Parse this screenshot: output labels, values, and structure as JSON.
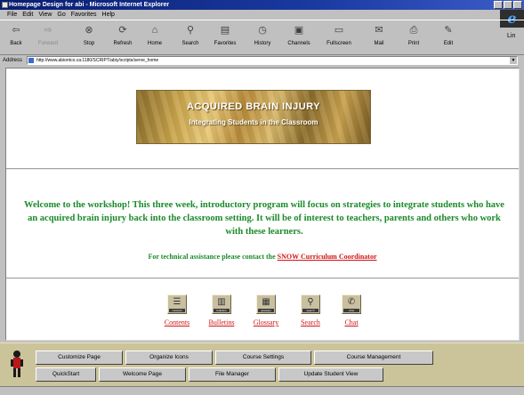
{
  "window": {
    "title": "Homepage Design for abi - Microsoft Internet Explorer"
  },
  "menu": [
    "File",
    "Edit",
    "View",
    "Go",
    "Favorites",
    "Help"
  ],
  "toolbar": {
    "buttons": [
      {
        "label": "Back",
        "icon": "back-arrow-icon"
      },
      {
        "label": "Forward",
        "icon": "forward-arrow-icon"
      },
      {
        "label": "Stop",
        "icon": "stop-icon"
      },
      {
        "label": "Refresh",
        "icon": "refresh-icon"
      },
      {
        "label": "Home",
        "icon": "home-icon"
      },
      {
        "label": "Search",
        "icon": "search-icon"
      },
      {
        "label": "Favorites",
        "icon": "favorites-icon"
      },
      {
        "label": "History",
        "icon": "history-icon"
      },
      {
        "label": "Channels",
        "icon": "channels-icon"
      },
      {
        "label": "Fullscreen",
        "icon": "fullscreen-icon"
      },
      {
        "label": "Mail",
        "icon": "mail-icon"
      },
      {
        "label": "Print",
        "icon": "print-icon"
      },
      {
        "label": "Edit",
        "icon": "edit-icon"
      }
    ],
    "links_label": "Lin"
  },
  "address": {
    "label": "Address",
    "value": "http://www.abiontco.ca:1180/SCRIPT/abiy/scripts/serve_home"
  },
  "banner": {
    "title": "ACQUIRED BRAIN INJURY",
    "subtitle": "Integrating Students in the Classroom"
  },
  "welcome_text": "Welcome to the workshop! This three week, introductory program will focus on strategies to integrate students who have an acquired brain injury back into the classroom setting. It will be of interest to teachers, parents and others who work with these learners.",
  "assist": {
    "text": "For technical assistance please contact the",
    "link": "SNOW Curriculum Coordinator"
  },
  "nav": [
    {
      "label": "Contents",
      "icon": "contents-icon",
      "caption": "contents"
    },
    {
      "label": "Bulletins",
      "icon": "bulletins-icon",
      "caption": "bulletins"
    },
    {
      "label": "Glossary",
      "icon": "glossary-icon",
      "caption": "glossary"
    },
    {
      "label": "Search",
      "icon": "search-icon",
      "caption": "search"
    },
    {
      "label": "Chat",
      "icon": "chat-icon",
      "caption": "chat"
    }
  ],
  "course_buttons": {
    "row1": [
      "Customize Page",
      "Organize Icons",
      "Course Settings",
      "Course Management"
    ],
    "row2": [
      "QuickStart",
      "Welcome Page",
      "File Manager",
      "Update Student View"
    ]
  },
  "colors": {
    "welcome_text": "#1a8a2a",
    "link": "#d01414",
    "course_bar": "#cbc49a"
  }
}
